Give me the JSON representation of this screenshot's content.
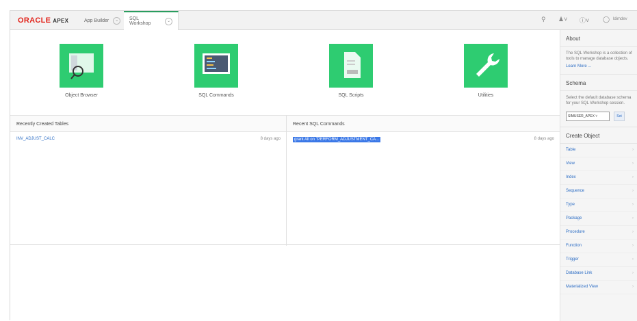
{
  "header": {
    "logo_text": "ORACLE",
    "logo_sub": "APEX",
    "tabs": [
      {
        "label": "App Builder"
      },
      {
        "label": "SQL Workshop"
      }
    ],
    "user_label": "ldimdev",
    "icons": [
      "search-icon",
      "person-icon",
      "help-icon",
      "user-icon"
    ]
  },
  "tiles": [
    {
      "label": "Object Browser",
      "icon": "object-browser-icon"
    },
    {
      "label": "SQL Commands",
      "icon": "sql-commands-icon"
    },
    {
      "label": "SQL Scripts",
      "icon": "sql-scripts-icon"
    },
    {
      "label": "Utilities",
      "icon": "wrench-icon"
    }
  ],
  "recent_tables": {
    "title": "Recently Created Tables",
    "items": [
      {
        "name": "INV_ADJUST_CALC",
        "age": "8 days ago"
      }
    ]
  },
  "recent_sql": {
    "title": "Recent SQL Commands",
    "items": [
      {
        "text": "grant All on \"PERFORM_ADJUSTMENT_CA...",
        "age": "8 days ago"
      }
    ]
  },
  "sidebar": {
    "about": {
      "title": "About",
      "text": "The SQL Workshop is a collection of tools to manage database objects.",
      "learn_more": "Learn More ..."
    },
    "schema": {
      "title": "Schema",
      "text": "Select the default database schema for your SQL Workshop session.",
      "selected": "SIMUSER_APEX",
      "set_label": "Set"
    },
    "create_object": {
      "title": "Create Object",
      "items": [
        "Table",
        "View",
        "Index",
        "Sequence",
        "Type",
        "Package",
        "Procedure",
        "Function",
        "Trigger",
        "Database Link",
        "Materialized View"
      ]
    }
  },
  "colors": {
    "tile_green": "#2ecc71",
    "oracle_red": "#e2231a",
    "link_blue": "#2b6cc4",
    "highlight_blue": "#3b78e7"
  }
}
